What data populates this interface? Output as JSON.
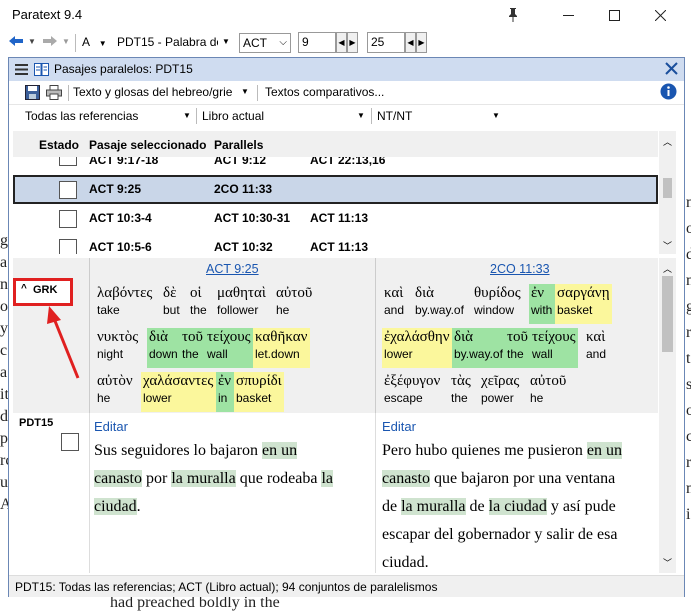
{
  "app": {
    "title": "Paratext 9.4"
  },
  "maintoolbar": {
    "font_letter": "A",
    "project": "PDT15 - Palabra de",
    "book": "ACT",
    "chapter": "9",
    "verse": "25"
  },
  "background": {
    "right_lines": [
      "ne",
      "o",
      "d",
      "n",
      "g",
      "r",
      "t",
      "s",
      "o",
      "c",
      "r",
      "n",
      "ie"
    ],
    "left_lines": [
      "g",
      "a",
      "n",
      "o",
      "y",
      "c",
      "a",
      "it",
      "d",
      "pi",
      "rc",
      "u",
      "A"
    ],
    "bottom": "had preached boldly in the"
  },
  "pp": {
    "title": "Pasajes paralelos: PDT15",
    "mode": "Texto y glosas del hebreo/grie",
    "compare": "Textos comparativos...",
    "filter_refs": "Todas las referencias",
    "filter_book": "Libro actual",
    "filter_testament": "NT/NT",
    "columns": {
      "status": "Estado",
      "passage": "Pasaje seleccionado",
      "parallels": "Parallels"
    },
    "rows": [
      {
        "passage": "ACT 9:17-18",
        "p1": "ACT 9:12",
        "p2": "ACT 22:13,16"
      },
      {
        "passage": "ACT 9:25",
        "p1": "2CO 11:33",
        "p2": ""
      },
      {
        "passage": "ACT 10:3-4",
        "p1": "ACT 10:30-31",
        "p2": "ACT 11:13"
      },
      {
        "passage": "ACT 10:5-6",
        "p1": "ACT 10:32",
        "p2": "ACT 11:13"
      }
    ],
    "grk_label": "GRK",
    "left_ref": "ACT 9:25",
    "right_ref": "2CO 11:33",
    "left_words": [
      [
        {
          "g": "λαβόντες",
          "e": "take",
          "h": ""
        },
        {
          "g": "δὲ",
          "e": "but",
          "h": ""
        },
        {
          "g": "οἱ",
          "e": "the",
          "h": ""
        },
        {
          "g": "μαθηταὶ",
          "e": "follower",
          "h": ""
        },
        {
          "g": "αὐτοῦ",
          "e": "he",
          "h": ""
        }
      ],
      [
        {
          "g": "νυκτὸς",
          "e": "night",
          "h": ""
        },
        {
          "g": "διὰ",
          "e": "down",
          "h": "g"
        },
        {
          "g": "τοῦ",
          "e": "the",
          "h": "g"
        },
        {
          "g": "τείχους",
          "e": "wall",
          "h": "g"
        },
        {
          "g": "καθῆκαν",
          "e": "let.down",
          "h": "y"
        }
      ],
      [
        {
          "g": "αὐτὸν",
          "e": "he",
          "h": ""
        },
        {
          "g": "χαλάσαντες",
          "e": "lower",
          "h": "y"
        },
        {
          "g": "ἐν",
          "e": "in",
          "h": "g"
        },
        {
          "g": "σπυρίδι",
          "e": "basket",
          "h": "y"
        }
      ]
    ],
    "right_words": [
      [
        {
          "g": "καὶ",
          "e": "and",
          "h": ""
        },
        {
          "g": "διὰ",
          "e": "by.way.of",
          "h": ""
        },
        {
          "g": "θυρίδος",
          "e": "window",
          "h": ""
        },
        {
          "g": "ἐν",
          "e": "with",
          "h": "g"
        },
        {
          "g": "σαργάνῃ",
          "e": "basket",
          "h": "y"
        }
      ],
      [
        {
          "g": "ἐχαλάσθην",
          "e": "lower",
          "h": "y"
        },
        {
          "g": "διὰ",
          "e": "by.way.of",
          "h": "g"
        },
        {
          "g": "τοῦ",
          "e": "the",
          "h": "g"
        },
        {
          "g": "τείχους",
          "e": "wall",
          "h": "g"
        },
        {
          "g": "καὶ",
          "e": "and",
          "h": ""
        }
      ],
      [
        {
          "g": "ἐξέφυγον",
          "e": "escape",
          "h": ""
        },
        {
          "g": "τὰς",
          "e": "the",
          "h": ""
        },
        {
          "g": "χεῖρας",
          "e": "power",
          "h": ""
        },
        {
          "g": "αὐτοῦ",
          "e": "he",
          "h": ""
        }
      ]
    ],
    "pdt_label": "PDT15",
    "edit_label": "Editar",
    "left_text": [
      [
        {
          "t": "Sus seguidores lo bajaron ",
          "h": false
        },
        {
          "t": "en un",
          "h": true
        }
      ],
      [
        {
          "t": "canasto",
          "h": true
        },
        {
          "t": " por ",
          "h": false
        },
        {
          "t": "la muralla",
          "h": true
        },
        {
          "t": " que rodeaba ",
          "h": false
        },
        {
          "t": "la",
          "h": true
        }
      ],
      [
        {
          "t": "ciudad",
          "h": true
        },
        {
          "t": ".",
          "h": false
        }
      ]
    ],
    "right_text": [
      [
        {
          "t": "Pero hubo quienes me pusieron ",
          "h": false
        },
        {
          "t": "en un",
          "h": true
        }
      ],
      [
        {
          "t": "canasto",
          "h": true
        },
        {
          "t": " que bajaron por una ventana",
          "h": false
        }
      ],
      [
        {
          "t": "de ",
          "h": false
        },
        {
          "t": "la muralla",
          "h": true
        },
        {
          "t": " de ",
          "h": false
        },
        {
          "t": "la ciudad",
          "h": true
        },
        {
          "t": " y así pude",
          "h": false
        }
      ],
      [
        {
          "t": "escapar del gobernador y salir de esa",
          "h": false
        }
      ],
      [
        {
          "t": "ciudad.",
          "h": false
        }
      ]
    ],
    "status": "PDT15: Todas las referencias; ACT (Libro actual); 94 conjuntos de paralelismos"
  },
  "colors": {
    "accent_blue": "#1a56b0",
    "green_hl": "#9ee3a3",
    "yellow_hl": "#fbf79c",
    "selected_row": "#c9d6e8",
    "annotation_red": "#e02020"
  }
}
